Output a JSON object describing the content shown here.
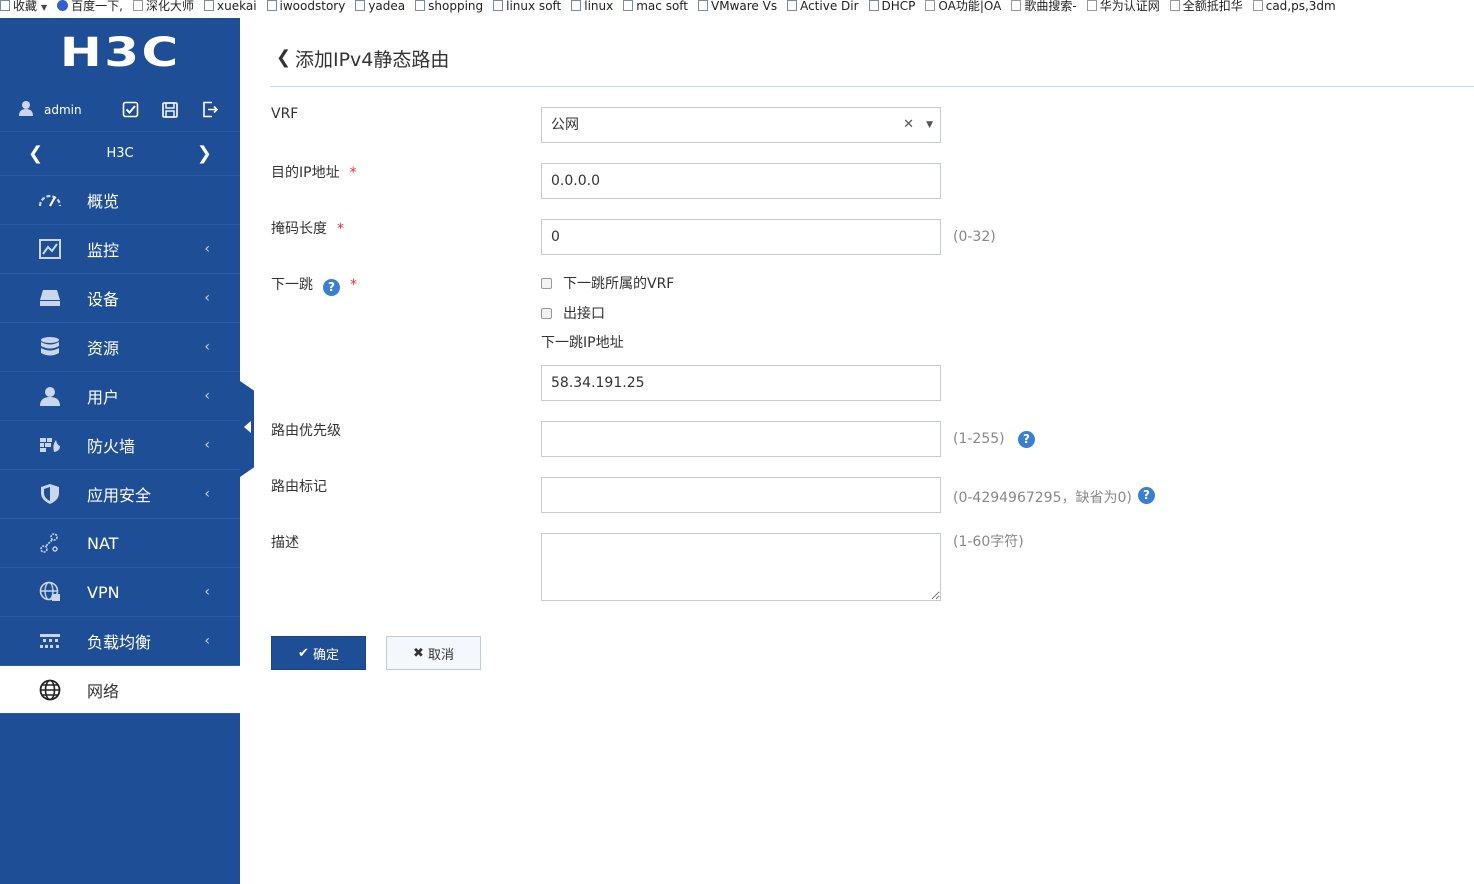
{
  "bookmarks": [
    {
      "label": "收藏",
      "icon": "folder-icon",
      "has_menu": true
    },
    {
      "label": "百度一下,",
      "icon": "baidu-paw-icon"
    },
    {
      "label": "深化大师",
      "icon": "doc-icon"
    },
    {
      "label": "xuekai",
      "icon": "folder-icon"
    },
    {
      "label": "iwoodstory",
      "icon": "folder-icon"
    },
    {
      "label": "yadea",
      "icon": "folder-icon"
    },
    {
      "label": "shopping",
      "icon": "folder-icon"
    },
    {
      "label": "linux soft",
      "icon": "folder-icon"
    },
    {
      "label": "linux",
      "icon": "folder-icon"
    },
    {
      "label": "mac soft",
      "icon": "folder-icon"
    },
    {
      "label": "VMware  Vs",
      "icon": "folder-icon"
    },
    {
      "label": "Active Dir",
      "icon": "folder-icon"
    },
    {
      "label": "DHCP",
      "icon": "folder-icon"
    },
    {
      "label": "OA功能|OA",
      "icon": "doc-icon"
    },
    {
      "label": "歌曲搜索-",
      "icon": "doc-icon"
    },
    {
      "label": "华为认证网",
      "icon": "doc-icon"
    },
    {
      "label": "全额抵扣华",
      "icon": "doc-icon"
    },
    {
      "label": "cad,ps,3dm",
      "icon": "doc-icon"
    }
  ],
  "sidebar": {
    "logo": "H3C",
    "user": "admin",
    "device": "H3C",
    "menu": [
      {
        "label": "概览",
        "icon": "dashboard-gauge-icon",
        "has_sub": false
      },
      {
        "label": "监控",
        "icon": "monitor-chart-icon",
        "has_sub": true
      },
      {
        "label": "设备",
        "icon": "device-icon",
        "has_sub": true
      },
      {
        "label": "资源",
        "icon": "database-icon",
        "has_sub": true
      },
      {
        "label": "用户",
        "icon": "user-icon",
        "has_sub": true
      },
      {
        "label": "防火墙",
        "icon": "firewall-icon",
        "has_sub": true
      },
      {
        "label": "应用安全",
        "icon": "shield-icon",
        "has_sub": true
      },
      {
        "label": "NAT",
        "icon": "nat-icon",
        "has_sub": false
      },
      {
        "label": "VPN",
        "icon": "globe-lock-icon",
        "has_sub": true
      },
      {
        "label": "负载均衡",
        "icon": "load-balance-icon",
        "has_sub": true
      },
      {
        "label": "网络",
        "icon": "globe-icon",
        "has_sub": false,
        "active": true
      }
    ]
  },
  "page": {
    "title": "添加IPv4静态路由"
  },
  "form": {
    "vrf_label": "VRF",
    "vrf_value": "公网",
    "dest_ip_label": "目的IP地址",
    "dest_ip_value": "0.0.0.0",
    "mask_label": "掩码长度",
    "mask_value": "0",
    "mask_hint": "(0-32)",
    "nexthop_label": "下一跳",
    "nexthop_vrf_check": "下一跳所属的VRF",
    "out_if_check": "出接口",
    "nexthop_ip_label": "下一跳IP地址",
    "nexthop_ip_value": "58.34.191.25",
    "priority_label": "路由优先级",
    "priority_value": "",
    "priority_hint": "(1-255)",
    "tag_label": "路由标记",
    "tag_value": "",
    "tag_hint": "(0-4294967295，缺省为0)",
    "desc_label": "描述",
    "desc_value": "",
    "desc_hint": "(1-60字符)",
    "required_mark": "*",
    "help_mark": "?",
    "ok_label": "确定",
    "cancel_label": "取消"
  },
  "colors": {
    "sidebar_bg": "#1e4e95",
    "primary_button": "#1e4e95",
    "required": "#e03030",
    "help_icon": "#3a7fd0"
  }
}
